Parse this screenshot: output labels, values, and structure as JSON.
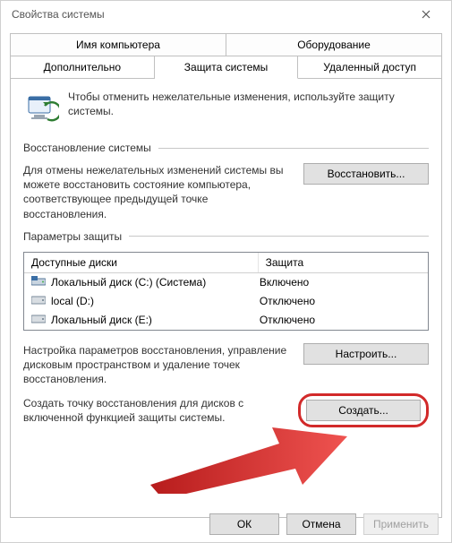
{
  "window": {
    "title": "Свойства системы"
  },
  "tabs": {
    "row1": [
      "Имя компьютера",
      "Оборудование"
    ],
    "row2": [
      "Дополнительно",
      "Защита системы",
      "Удаленный доступ"
    ],
    "active": "Защита системы"
  },
  "intro": {
    "text": "Чтобы отменить нежелательные изменения, используйте защиту системы."
  },
  "restore": {
    "section_title": "Восстановление системы",
    "desc": "Для отмены нежелательных изменений системы вы можете восстановить состояние компьютера, соответствующее предыдущей точке восстановления.",
    "button": "Восстановить..."
  },
  "protection": {
    "section_title": "Параметры защиты",
    "columns": {
      "disk": "Доступные диски",
      "prot": "Защита"
    },
    "drives": [
      {
        "name": "Локальный диск (C:) (Система)",
        "status": "Включено",
        "icon": "sys"
      },
      {
        "name": "local (D:)",
        "status": "Отключено",
        "icon": "hdd"
      },
      {
        "name": "Локальный диск (E:)",
        "status": "Отключено",
        "icon": "hdd"
      }
    ],
    "configure_desc": "Настройка параметров восстановления, управление дисковым пространством и удаление точек восстановления.",
    "configure_button": "Настроить...",
    "create_desc": "Создать точку восстановления для дисков с включенной функцией защиты системы.",
    "create_button": "Создать..."
  },
  "buttons": {
    "ok": "ОК",
    "cancel": "Отмена",
    "apply": "Применить"
  }
}
